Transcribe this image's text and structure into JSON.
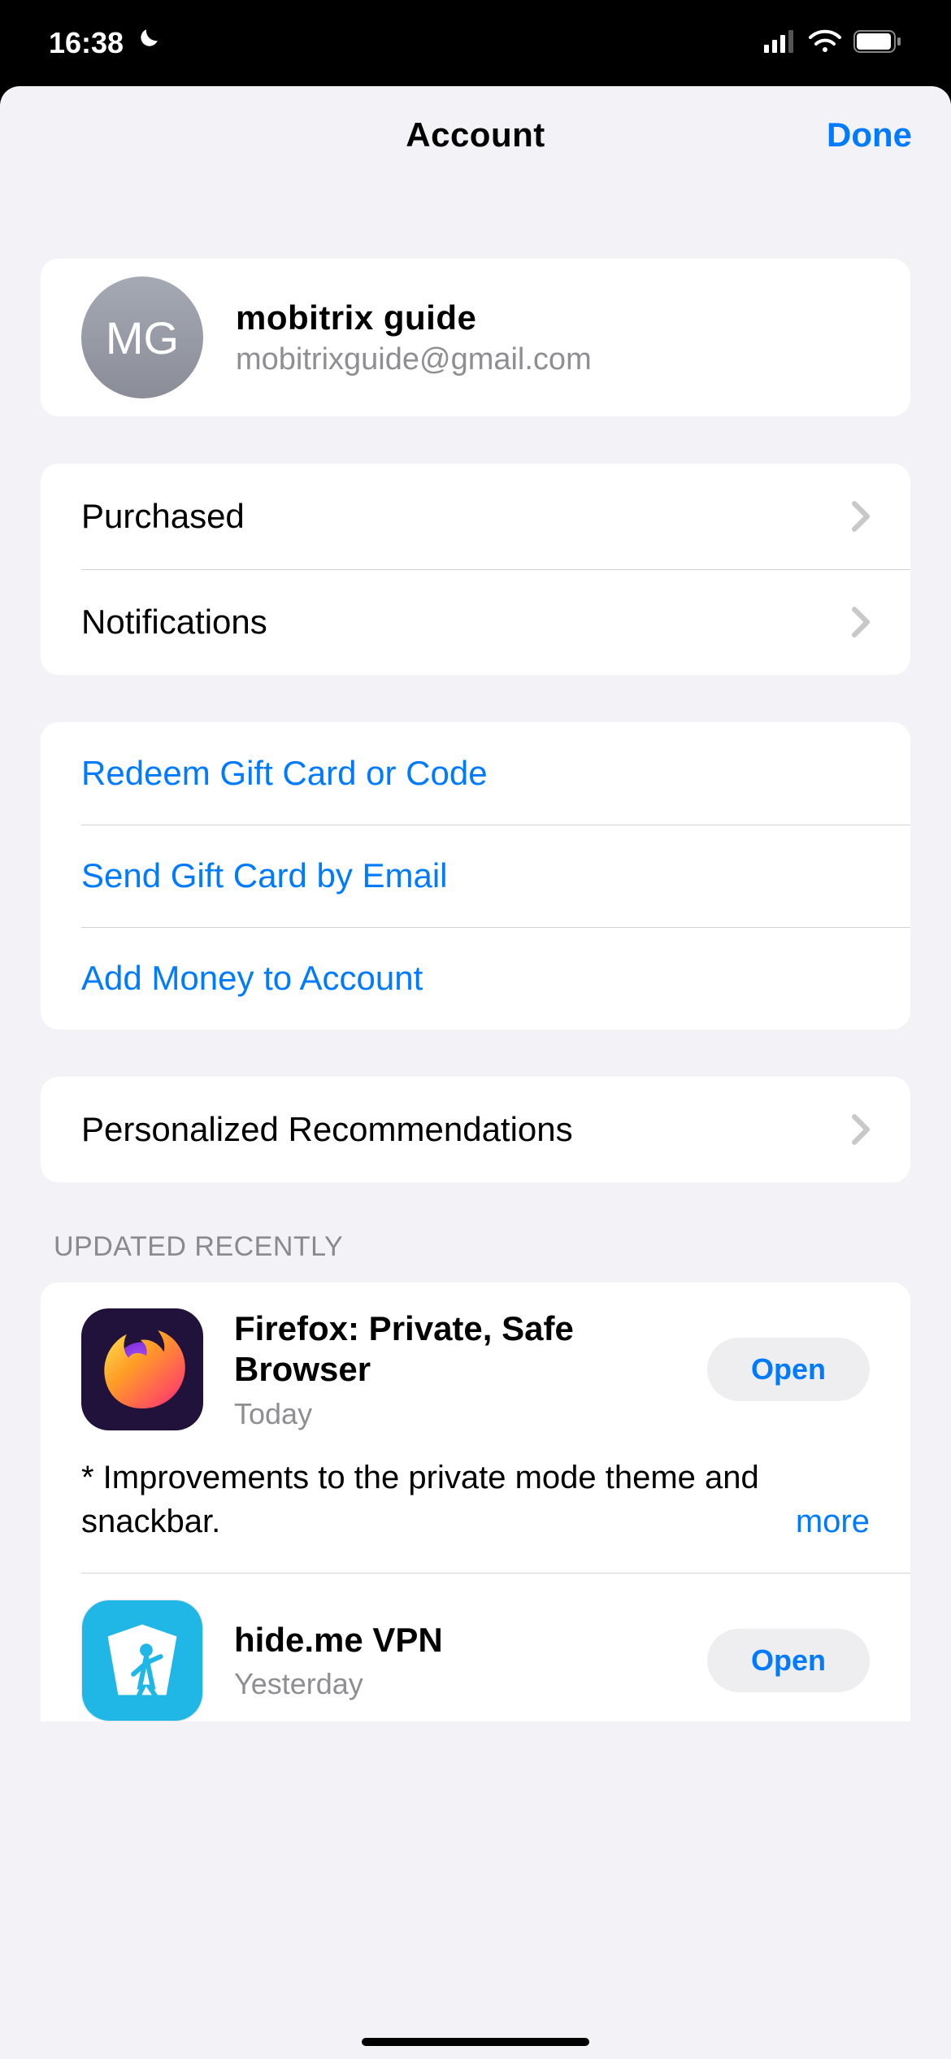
{
  "statusbar": {
    "time": "16:38"
  },
  "navbar": {
    "title": "Account",
    "done": "Done"
  },
  "profile": {
    "initials": "MG",
    "name": "mobitrix guide",
    "email": "mobitrixguide@gmail.com"
  },
  "sections": {
    "items1": [
      {
        "label": "Purchased"
      },
      {
        "label": "Notifications"
      }
    ],
    "items2": [
      {
        "label": "Redeem Gift Card or Code"
      },
      {
        "label": "Send Gift Card by Email"
      },
      {
        "label": "Add Money to Account"
      }
    ],
    "items3": [
      {
        "label": "Personalized Recommendations"
      }
    ]
  },
  "updated": {
    "header": "UPDATED RECENTLY",
    "apps": [
      {
        "name": "Firefox: Private, Safe Browser",
        "date": "Today",
        "open": "Open",
        "notes": "* Improvements to the private mode theme and snackbar.",
        "more": "more"
      },
      {
        "name": "hide.me VPN",
        "date": "Yesterday",
        "open": "Open"
      }
    ]
  }
}
